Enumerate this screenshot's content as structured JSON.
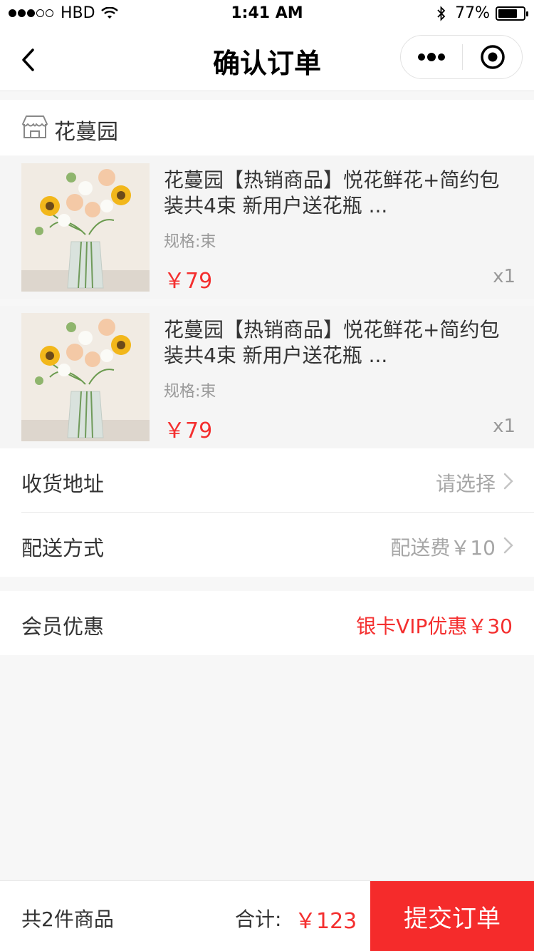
{
  "status_bar": {
    "carrier": "HBD",
    "time": "1:41 AM",
    "battery": "77%",
    "battery_level": 0.77
  },
  "nav": {
    "title": "确认订单",
    "back_icon": "chevron-left-icon",
    "more_icon": "more-dots-icon",
    "close_icon": "target-icon"
  },
  "shop": {
    "name": "花蔓园",
    "icon": "shop-icon"
  },
  "products": [
    {
      "title": "花蔓园【热销商品】悦花鲜花+简约包装共4束 新用户送花瓶 ...",
      "spec": "规格:束",
      "price": "￥79",
      "qty": "x1"
    },
    {
      "title": "花蔓园【热销商品】悦花鲜花+简约包装共4束 新用户送花瓶 ...",
      "spec": "规格:束",
      "price": "￥79",
      "qty": "x1"
    }
  ],
  "address": {
    "label": "收货地址",
    "value": "请选择"
  },
  "delivery": {
    "label": "配送方式",
    "value": "配送费￥10"
  },
  "member": {
    "label": "会员优惠",
    "value": "银卡VIP优惠￥30"
  },
  "bottom": {
    "count_text": "共2件商品",
    "total_label": "合计:",
    "total_amount": "￥123",
    "submit_label": "提交订单"
  },
  "colors": {
    "accent_red": "#f42f2f",
    "button_red": "#f52b2b",
    "page_bg": "#f7f7f7"
  }
}
